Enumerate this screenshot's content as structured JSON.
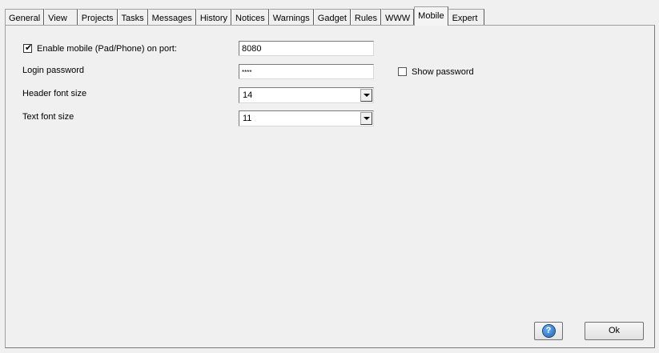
{
  "tabs": [
    {
      "label": "General"
    },
    {
      "label": "View"
    },
    {
      "label": "Projects"
    },
    {
      "label": "Tasks"
    },
    {
      "label": "Messages"
    },
    {
      "label": "History"
    },
    {
      "label": "Notices"
    },
    {
      "label": "Warnings"
    },
    {
      "label": "Gadget"
    },
    {
      "label": "Rules"
    },
    {
      "label": "WWW"
    },
    {
      "label": "Mobile"
    },
    {
      "label": "Expert"
    }
  ],
  "active_tab": "Mobile",
  "mobile": {
    "enable_label": "Enable mobile (Pad/Phone) on port:",
    "enable_checked": true,
    "port_value": "8080",
    "password_label": "Login password",
    "password_value": "****",
    "show_password_label": "Show password",
    "show_password_checked": false,
    "header_font_label": "Header font size",
    "header_font_value": "14",
    "text_font_label": "Text font size",
    "text_font_value": "11"
  },
  "buttons": {
    "help_glyph": "?",
    "ok_label": "Ok"
  }
}
